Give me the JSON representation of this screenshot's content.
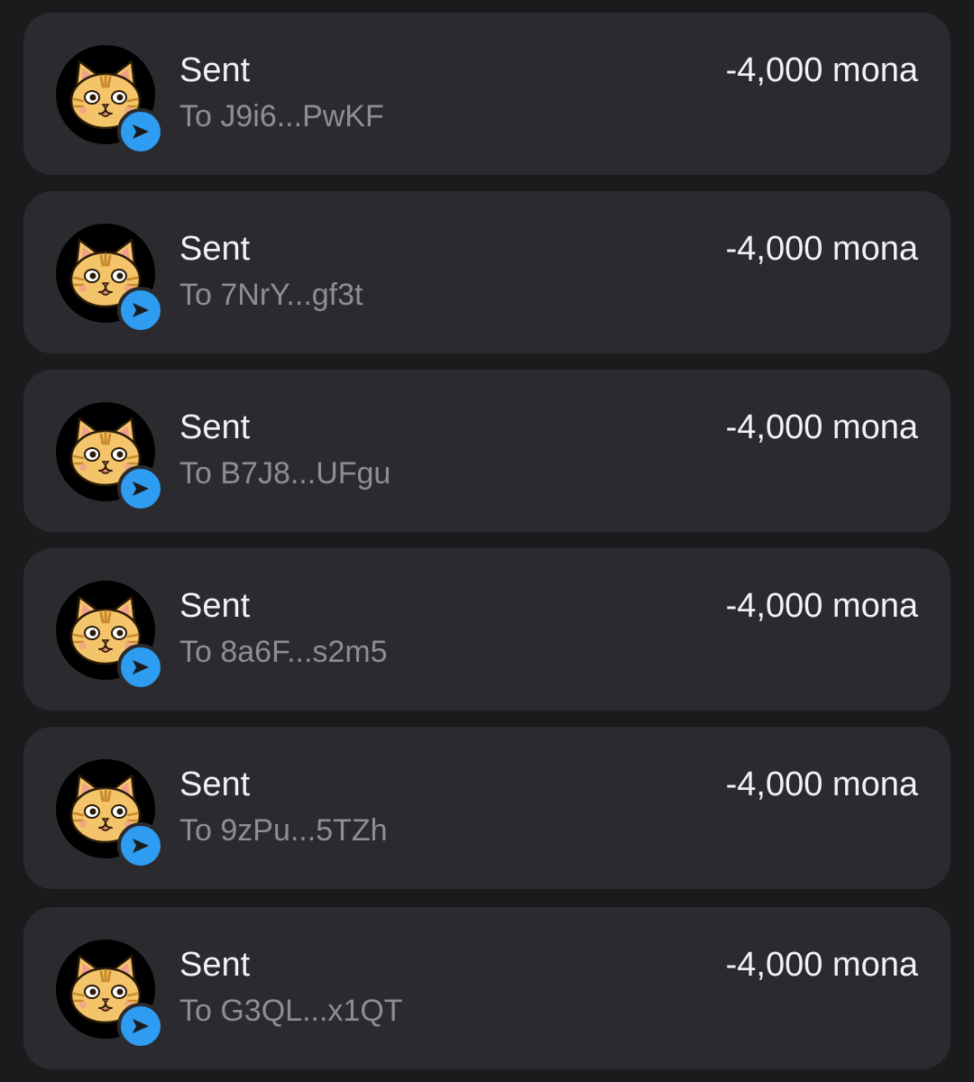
{
  "transactions": [
    {
      "title": "Sent",
      "recipient": "To J9i6...PwKF",
      "amount": "-4,000 mona"
    },
    {
      "title": "Sent",
      "recipient": "To 7NrY...gf3t",
      "amount": "-4,000 mona"
    },
    {
      "title": "Sent",
      "recipient": "To B7J8...UFgu",
      "amount": "-4,000 mona"
    },
    {
      "title": "Sent",
      "recipient": "To 8a6F...s2m5",
      "amount": "-4,000 mona"
    },
    {
      "title": "Sent",
      "recipient": "To 9zPu...5TZh",
      "amount": "-4,000 mona"
    },
    {
      "title": "Sent",
      "recipient": "To G3QL...x1QT",
      "amount": "-4,000 mona"
    }
  ],
  "icons": {
    "avatar": "cat-avatar-icon",
    "badge": "send-arrow-icon"
  },
  "colors": {
    "background": "#1b1b1d",
    "card": "#2b2b2f",
    "badge": "#2e9cf0",
    "primary_text": "#f2f2f4",
    "secondary_text": "#8d8d93",
    "cat_fur": "#f3c46a"
  }
}
